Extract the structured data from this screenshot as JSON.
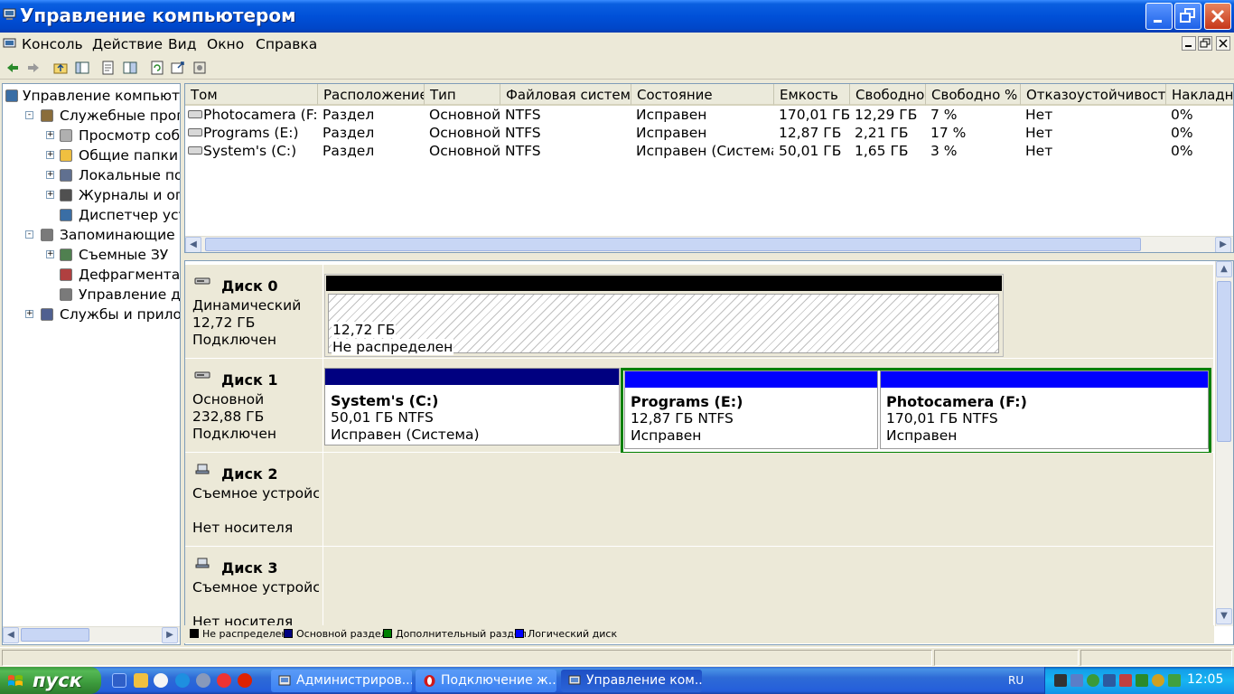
{
  "window": {
    "title": "Управление компьютером",
    "menu": [
      "Консоль",
      "Действие",
      "Вид",
      "Окно",
      "Справка"
    ]
  },
  "tree": [
    {
      "label": "Управление компьютер",
      "level": 0,
      "expander": "",
      "icon": "computer-icon"
    },
    {
      "label": "Служебные програм",
      "level": 1,
      "expander": "-",
      "icon": "tools-icon"
    },
    {
      "label": "Просмотр событи",
      "level": 2,
      "expander": "+",
      "icon": "event-viewer-icon"
    },
    {
      "label": "Общие папки",
      "level": 2,
      "expander": "+",
      "icon": "shared-folder-icon"
    },
    {
      "label": "Локальные польз",
      "level": 2,
      "expander": "+",
      "icon": "users-icon"
    },
    {
      "label": "Журналы и опове",
      "level": 2,
      "expander": "+",
      "icon": "performance-logs-icon"
    },
    {
      "label": "Диспетчер устрой",
      "level": 2,
      "expander": "",
      "icon": "device-manager-icon"
    },
    {
      "label": "Запоминающие устр",
      "level": 1,
      "expander": "-",
      "icon": "storage-icon"
    },
    {
      "label": "Съемные ЗУ",
      "level": 2,
      "expander": "+",
      "icon": "removable-storage-icon"
    },
    {
      "label": "Дефрагментация д",
      "level": 2,
      "expander": "",
      "icon": "defrag-icon"
    },
    {
      "label": "Управление диска",
      "level": 2,
      "expander": "",
      "icon": "disk-management-icon"
    },
    {
      "label": "Службы и приложен",
      "level": 1,
      "expander": "+",
      "icon": "services-icon"
    }
  ],
  "volumes": {
    "columns": [
      "Том",
      "Расположение",
      "Тип",
      "Файловая система",
      "Состояние",
      "Емкость",
      "Свободно",
      "Свободно %",
      "Отказоустойчивость",
      "Накладн"
    ],
    "rows": [
      [
        "Photocamera (F:)",
        "Раздел",
        "Основной",
        "NTFS",
        "Исправен",
        "170,01 ГБ",
        "12,29 ГБ",
        "7 %",
        "Нет",
        "0%"
      ],
      [
        "Programs (E:)",
        "Раздел",
        "Основной",
        "NTFS",
        "Исправен",
        "12,87 ГБ",
        "2,21 ГБ",
        "17 %",
        "Нет",
        "0%"
      ],
      [
        "System's (C:)",
        "Раздел",
        "Основной",
        "NTFS",
        "Исправен (Система)",
        "50,01 ГБ",
        "1,65 ГБ",
        "3 %",
        "Нет",
        "0%"
      ]
    ]
  },
  "disks": [
    {
      "name": "Диск 0",
      "type": "Динамический",
      "size": "12,72 ГБ",
      "status": "Подключен",
      "partitions": [
        {
          "name": "",
          "size": "12,72 ГБ",
          "status": "Не распределен",
          "kind": "unallocated"
        }
      ]
    },
    {
      "name": "Диск 1",
      "type": "Основной",
      "size": "232,88 ГБ",
      "status": "Подключен",
      "partitions": [
        {
          "name": "System's  (C:)",
          "size": "50,01 ГБ NTFS",
          "status": "Исправен (Система)",
          "kind": "primary"
        },
        {
          "name": "Programs  (E:)",
          "size": "12,87 ГБ NTFS",
          "status": "Исправен",
          "kind": "logical"
        },
        {
          "name": "Photocamera  (F:)",
          "size": "170,01 ГБ NTFS",
          "status": "Исправен",
          "kind": "logical"
        }
      ]
    },
    {
      "name": "Диск 2",
      "type": "Съемное устройств",
      "size": "",
      "status": "Нет носителя",
      "partitions": []
    },
    {
      "name": "Диск 3",
      "type": "Съемное устройств",
      "size": "",
      "status": "Нет носителя",
      "partitions": []
    }
  ],
  "legend": [
    {
      "label": "Не распределен",
      "color": "#000000"
    },
    {
      "label": "Основной раздел",
      "color": "#000080"
    },
    {
      "label": "Дополнительный раздел",
      "color": "#008000"
    },
    {
      "label": "Логический диск",
      "color": "#0000ff"
    }
  ],
  "taskbar": {
    "start_label": "пуск",
    "tasks": [
      "Администриров...",
      "Подключение ж...",
      "Управление ком..."
    ],
    "language": "RU",
    "clock": "12:05"
  },
  "colors": {
    "unallocated": "#000000",
    "primary": "#000080",
    "extended": "#008000",
    "logical": "#0000ff"
  }
}
